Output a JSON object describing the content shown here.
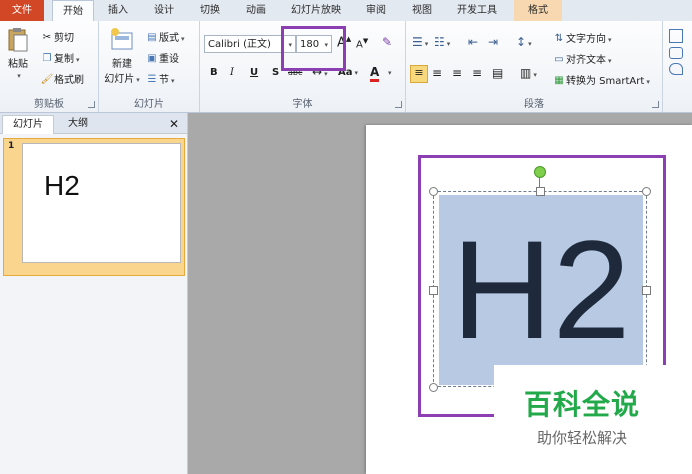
{
  "tabs": [
    {
      "label": "文件",
      "kind": "file"
    },
    {
      "label": "开始",
      "kind": "active"
    },
    {
      "label": "插入",
      "kind": ""
    },
    {
      "label": "设计",
      "kind": ""
    },
    {
      "label": "切换",
      "kind": ""
    },
    {
      "label": "动画",
      "kind": ""
    },
    {
      "label": "幻灯片放映",
      "kind": ""
    },
    {
      "label": "审阅",
      "kind": ""
    },
    {
      "label": "视图",
      "kind": ""
    },
    {
      "label": "开发工具",
      "kind": ""
    },
    {
      "label": "格式",
      "kind": "ctx"
    }
  ],
  "clipboard": {
    "paste": "粘贴",
    "cut": "剪切",
    "copy": "复制",
    "format_painter": "格式刷",
    "label": "剪贴板"
  },
  "slides_group": {
    "new_slide": "新建",
    "new_slide2": "幻灯片",
    "layout": "版式",
    "reset": "重设",
    "section": "节",
    "label": "幻灯片"
  },
  "font": {
    "name": "Calibri (正文)",
    "size": "180",
    "grow": "A",
    "shrink": "A",
    "bold": "B",
    "italic": "I",
    "underline": "U",
    "shadow": "S",
    "strike": "abc",
    "case": "Aa",
    "color": "A",
    "label": "字体"
  },
  "paragraph": {
    "text_direction": "文字方向",
    "align_text": "对齐文本",
    "smartart": "转换为 SmartArt",
    "label": "段落"
  },
  "panel": {
    "tab_slides": "幻灯片",
    "tab_outline": "大纲",
    "close": "✕",
    "slide_number": "1",
    "thumb_text": "H2"
  },
  "slide": {
    "text": "H2"
  },
  "watermark": {
    "title": "百科全说",
    "subtitle": "助你轻松解决"
  },
  "colors": {
    "file_tab": "#d24726",
    "highlight": "#8b3fb3",
    "selection": "#b8c9e3",
    "watermark_green": "#22a94a"
  }
}
